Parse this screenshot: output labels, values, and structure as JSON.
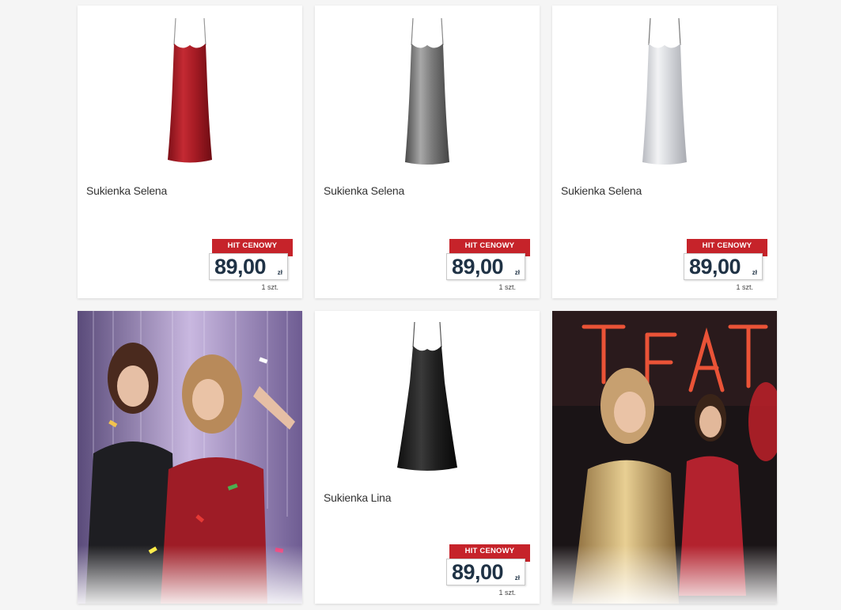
{
  "products": [
    {
      "name": "Sukienka Selena",
      "badge": "HIT CENOWY",
      "price": "89,00",
      "currency": "zł",
      "unit": "1 szt.",
      "color": "#b01e28"
    },
    {
      "name": "Sukienka Selena",
      "badge": "HIT CENOWY",
      "price": "89,00",
      "currency": "zł",
      "unit": "1 szt.",
      "color": "#7a7a7a"
    },
    {
      "name": "Sukienka Selena",
      "badge": "HIT CENOWY",
      "price": "89,00",
      "currency": "zł",
      "unit": "1 szt.",
      "color": "#d6d8dc"
    },
    {
      "name": "Sukienka Lina",
      "badge": "HIT CENOWY",
      "price": "89,00",
      "currency": "zł",
      "unit": "1 szt.",
      "color": "#1c1c1c"
    }
  ],
  "colors": {
    "badge_red": "#c6232a",
    "price_navy": "#1f3245"
  }
}
